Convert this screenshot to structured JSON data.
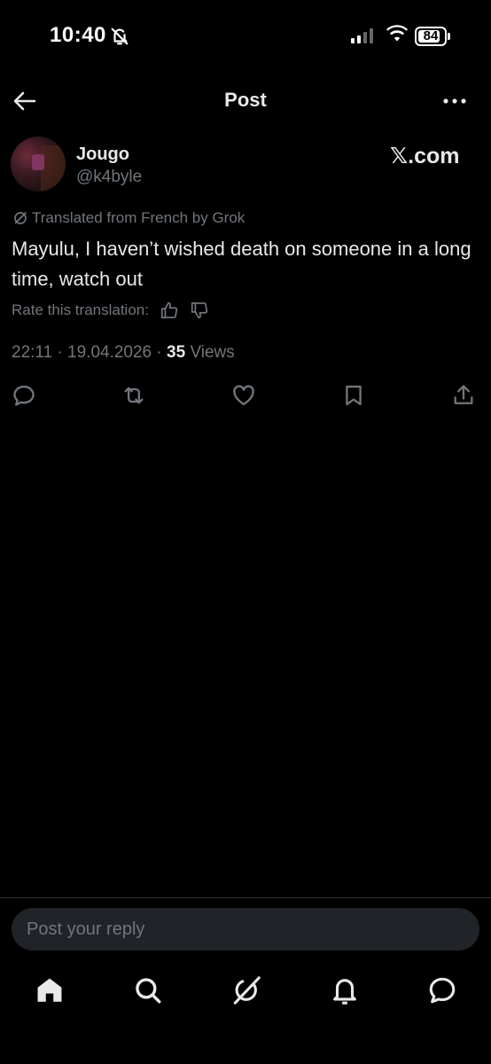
{
  "status_bar": {
    "time": "10:40",
    "battery": "84",
    "battery_level": 0.84,
    "icons": [
      "bell-off-icon",
      "signal-icon",
      "wifi-icon",
      "battery-icon"
    ]
  },
  "header": {
    "title": "Post",
    "back_icon": "arrow-left-icon",
    "more_icon": "more-icon"
  },
  "post": {
    "author": {
      "name": "Jougo",
      "handle": "@k4byle"
    },
    "brand": "𝕏.com",
    "translation_note": "Translated from French by Grok",
    "text": "Mayulu, I haven’t wished death on someone in a long time, watch out",
    "rate_label": "Rate this translation:",
    "time": "22:11",
    "date": "19.04.2026",
    "views_count": "35",
    "views_label": "Views"
  },
  "actions": [
    "reply-icon",
    "repost-icon",
    "like-icon",
    "bookmark-icon",
    "share-icon"
  ],
  "reply": {
    "placeholder": "Post your reply"
  },
  "bottom_nav": [
    "home-icon",
    "search-icon",
    "grok-icon",
    "notifications-icon",
    "messages-icon"
  ],
  "colors": {
    "background": "#000000",
    "text": "#e7e9ea",
    "secondary": "#71767b",
    "input_bg": "#202327"
  }
}
